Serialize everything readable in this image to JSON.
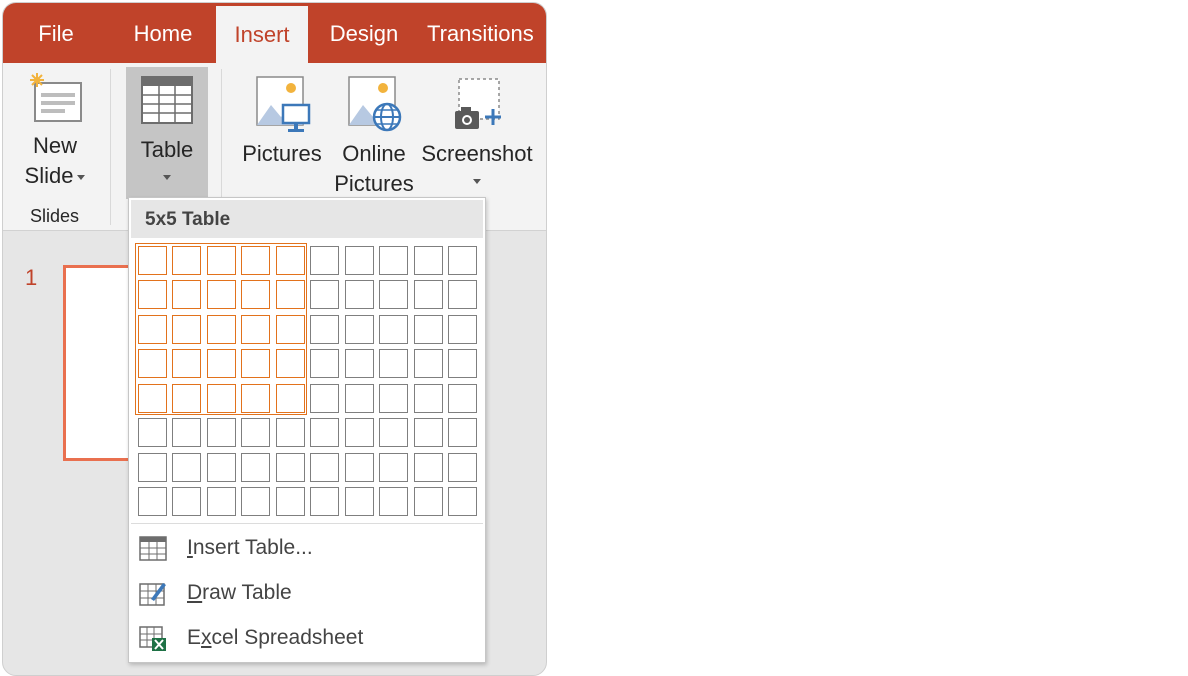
{
  "tabs": [
    {
      "label": "File",
      "active": false
    },
    {
      "label": "Home",
      "active": false
    },
    {
      "label": "Insert",
      "active": true
    },
    {
      "label": "Design",
      "active": false
    },
    {
      "label": "Transitions",
      "active": false
    }
  ],
  "ribbon": {
    "new_slide": {
      "line1": "New",
      "line2": "Slide"
    },
    "table": {
      "label": "Table"
    },
    "pictures": {
      "label": "Pictures"
    },
    "online_pictures": {
      "line1": "Online",
      "line2": "Pictures"
    },
    "screenshot": {
      "label": "Screenshot"
    },
    "slides_group_label": "Slides"
  },
  "slide_panel": {
    "slide_number": "1"
  },
  "table_dropdown": {
    "header": "5x5 Table",
    "grid": {
      "columns": 10,
      "rows": 8,
      "selected_columns": 5,
      "selected_rows": 5
    },
    "menu_items": [
      {
        "pre": "",
        "ul": "I",
        "post": "nsert Table..."
      },
      {
        "pre": "",
        "ul": "D",
        "post": "raw Table"
      },
      {
        "pre": "E",
        "ul": "x",
        "post": "cel Spreadsheet"
      }
    ]
  },
  "colors": {
    "accent": "#c0432a",
    "selection": "#e2721c",
    "slide_border": "#e9704f"
  }
}
